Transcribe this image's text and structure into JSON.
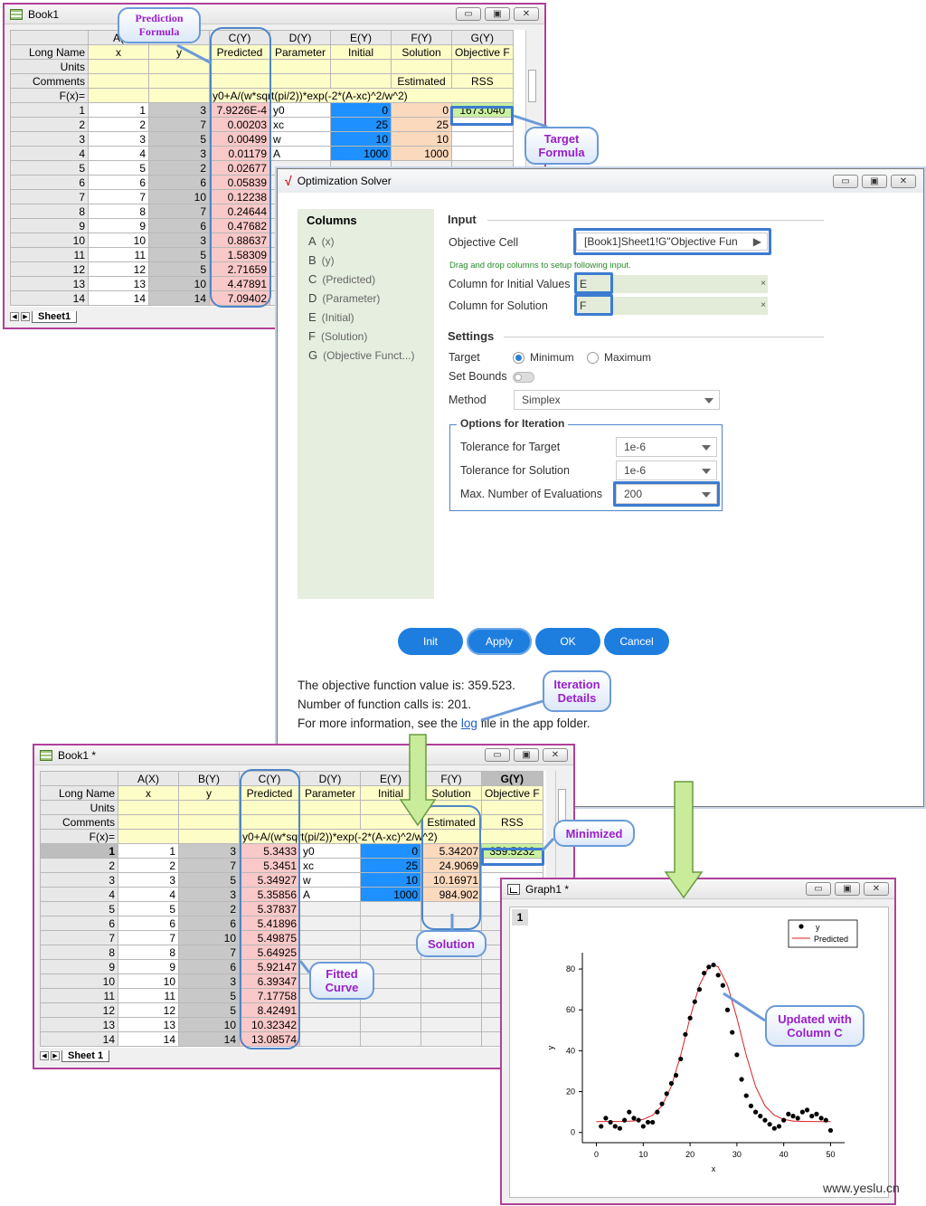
{
  "book1": {
    "title": "Book1",
    "col_headers": [
      "A(X)",
      "B(Y)",
      "C(Y)",
      "D(Y)",
      "E(Y)",
      "F(Y)",
      "G(Y)"
    ],
    "col_headers_visible": [
      "A(",
      "",
      "C(Y)",
      "D(Y)",
      "E(Y)",
      "F(Y)",
      "G(Y)"
    ],
    "row_labels": [
      "Long Name",
      "Units",
      "Comments",
      "F(x)="
    ],
    "long_names": [
      "x",
      "y",
      "Predicted",
      "Parameter",
      "Initial",
      "Solution",
      "Objective F"
    ],
    "comments": [
      "",
      "",
      "",
      "",
      "",
      "Estimated",
      "RSS"
    ],
    "formula": "y0+A/(w*sqrt(pi/2))*exp(-2*(A-xc)^2/w^2)",
    "rows": [
      {
        "n": "1",
        "x": "1",
        "y": "3",
        "c": "7.9226E-4",
        "d": "y0",
        "e": "0",
        "f": "0",
        "g": "1673.040"
      },
      {
        "n": "2",
        "x": "2",
        "y": "7",
        "c": "0.00203",
        "d": "xc",
        "e": "25",
        "f": "25",
        "g": ""
      },
      {
        "n": "3",
        "x": "3",
        "y": "5",
        "c": "0.00499",
        "d": "w",
        "e": "10",
        "f": "10",
        "g": ""
      },
      {
        "n": "4",
        "x": "4",
        "y": "3",
        "c": "0.01179",
        "d": "A",
        "e": "1000",
        "f": "1000",
        "g": ""
      },
      {
        "n": "5",
        "x": "5",
        "y": "2",
        "c": "0.02677"
      },
      {
        "n": "6",
        "x": "6",
        "y": "6",
        "c": "0.05839"
      },
      {
        "n": "7",
        "x": "7",
        "y": "10",
        "c": "0.12238"
      },
      {
        "n": "8",
        "x": "8",
        "y": "7",
        "c": "0.24644"
      },
      {
        "n": "9",
        "x": "9",
        "y": "6",
        "c": "0.47682"
      },
      {
        "n": "10",
        "x": "10",
        "y": "3",
        "c": "0.88637"
      },
      {
        "n": "11",
        "x": "11",
        "y": "5",
        "c": "1.58309"
      },
      {
        "n": "12",
        "x": "12",
        "y": "5",
        "c": "2.71659"
      },
      {
        "n": "13",
        "x": "13",
        "y": "10",
        "c": "4.47891"
      },
      {
        "n": "14",
        "x": "14",
        "y": "14",
        "c": "7.09402"
      }
    ],
    "sheet_tab": "Sheet1"
  },
  "book1_star": {
    "title": "Book1 *",
    "col_headers": [
      "A(X)",
      "B(Y)",
      "C(Y)",
      "D(Y)",
      "E(Y)",
      "F(Y)",
      "G(Y)"
    ],
    "rows": [
      {
        "n": "1",
        "x": "1",
        "y": "3",
        "c": "5.3433",
        "d": "y0",
        "e": "0",
        "f": "5.34207",
        "g": "359.5232"
      },
      {
        "n": "2",
        "x": "2",
        "y": "7",
        "c": "5.3451",
        "d": "xc",
        "e": "25",
        "f": "24.9069",
        "g": ""
      },
      {
        "n": "3",
        "x": "3",
        "y": "5",
        "c": "5.34927",
        "d": "w",
        "e": "10",
        "f": "10.16971",
        "g": ""
      },
      {
        "n": "4",
        "x": "4",
        "y": "3",
        "c": "5.35856",
        "d": "A",
        "e": "1000",
        "f": "984.902",
        "g": ""
      },
      {
        "n": "5",
        "x": "5",
        "y": "2",
        "c": "5.37837"
      },
      {
        "n": "6",
        "x": "6",
        "y": "6",
        "c": "5.41896"
      },
      {
        "n": "7",
        "x": "7",
        "y": "10",
        "c": "5.49875"
      },
      {
        "n": "8",
        "x": "8",
        "y": "7",
        "c": "5.64925"
      },
      {
        "n": "9",
        "x": "9",
        "y": "6",
        "c": "5.92147"
      },
      {
        "n": "10",
        "x": "10",
        "y": "3",
        "c": "6.39347"
      },
      {
        "n": "11",
        "x": "11",
        "y": "5",
        "c": "7.17758"
      },
      {
        "n": "12",
        "x": "12",
        "y": "5",
        "c": "8.42491"
      },
      {
        "n": "13",
        "x": "13",
        "y": "10",
        "c": "10.32342"
      },
      {
        "n": "14",
        "x": "14",
        "y": "14",
        "c": "13.08574"
      }
    ],
    "sheet_tab": "Sheet 1"
  },
  "solver": {
    "title": "Optimization Solver",
    "columns_title": "Columns",
    "columns": [
      {
        "k": "A",
        "v": "(x)"
      },
      {
        "k": "B",
        "v": "(y)"
      },
      {
        "k": "C",
        "v": "(Predicted)"
      },
      {
        "k": "D",
        "v": "(Parameter)"
      },
      {
        "k": "E",
        "v": "(Initial)"
      },
      {
        "k": "F",
        "v": "(Solution)"
      },
      {
        "k": "G",
        "v": "(Objective Funct...)"
      }
    ],
    "input_title": "Input",
    "objective_cell_label": "Objective Cell",
    "objective_cell_value": "[Book1]Sheet1!G\"Objective Fun",
    "hint": "Drag and drop columns to setup following input.",
    "initial_label": "Column for Initial Values",
    "initial_value": "E",
    "solution_label": "Column for Solution",
    "solution_value": "F",
    "settings_title": "Settings",
    "target_label": "Target",
    "minimum": "Minimum",
    "maximum": "Maximum",
    "set_bounds_label": "Set Bounds",
    "method_label": "Method",
    "method_value": "Simplex",
    "iter_title": "Options for Iteration",
    "tol_target_label": "Tolerance for Target",
    "tol_target_value": "1e-6",
    "tol_solution_label": "Tolerance for Solution",
    "tol_solution_value": "1e-6",
    "max_eval_label": "Max. Number of Evaluations",
    "max_eval_value": "200",
    "buttons": {
      "init": "Init",
      "apply": "Apply",
      "ok": "OK",
      "cancel": "Cancel"
    },
    "result_line1": "The objective function value is: 359.523.",
    "result_line2": "Number of function calls is: 201.",
    "result_line3_pre": "For more information, see the",
    "result_link": "log",
    "result_line3_post": "file in the app folder."
  },
  "callouts": {
    "prediction": "Prediction Formula",
    "target": "Target Formula",
    "iteration": "Iteration Details",
    "minimized": "Minimized",
    "solution": "Solution",
    "fitted": "Fitted Curve",
    "updated": "Updated with Column C"
  },
  "graph": {
    "title": "Graph1 *",
    "layer": "1",
    "legend": [
      "y",
      "Predicted"
    ],
    "xlabel": "x",
    "ylabel": "y"
  },
  "chart_data": {
    "type": "scatter",
    "xlabel": "x",
    "ylabel": "y",
    "xlim": [
      -3,
      53
    ],
    "ylim": [
      -5,
      88
    ],
    "xticks": [
      0,
      10,
      20,
      30,
      40,
      50
    ],
    "yticks": [
      0,
      20,
      40,
      60,
      80
    ],
    "series": [
      {
        "name": "y",
        "type": "scatter",
        "x": [
          1,
          2,
          3,
          4,
          5,
          6,
          7,
          8,
          9,
          10,
          11,
          12,
          13,
          14,
          15,
          16,
          17,
          18,
          19,
          20,
          21,
          22,
          23,
          24,
          25,
          26,
          27,
          28,
          29,
          30,
          31,
          32,
          33,
          34,
          35,
          36,
          37,
          38,
          39,
          40,
          41,
          42,
          43,
          44,
          45,
          46,
          47,
          48,
          49,
          50
        ],
        "y": [
          3,
          7,
          5,
          3,
          2,
          6,
          10,
          7,
          6,
          3,
          5,
          5,
          10,
          14,
          19,
          24,
          28,
          36,
          48,
          56,
          64,
          70,
          78,
          81,
          82,
          77,
          72,
          60,
          49,
          38,
          26,
          18,
          13,
          10,
          8,
          6,
          4,
          2,
          3,
          6,
          9,
          8,
          7,
          10,
          11,
          8,
          9,
          7,
          6,
          1
        ]
      },
      {
        "name": "Predicted",
        "type": "line",
        "color": "#e02020",
        "x": [
          0,
          2,
          4,
          6,
          8,
          10,
          12,
          14,
          16,
          18,
          20,
          22,
          24,
          25,
          26,
          28,
          30,
          32,
          34,
          36,
          38,
          40,
          42,
          44,
          46,
          48,
          50
        ],
        "y": [
          5.3,
          5.35,
          5.36,
          5.42,
          5.65,
          6.39,
          8.42,
          13.09,
          22.6,
          37.9,
          56.2,
          72.2,
          81.1,
          82.0,
          81.0,
          72.0,
          56.0,
          37.6,
          22.4,
          13.0,
          8.4,
          6.4,
          5.6,
          5.4,
          5.35,
          5.34,
          5.34
        ]
      }
    ]
  },
  "footer": "www.yeslu.cn"
}
